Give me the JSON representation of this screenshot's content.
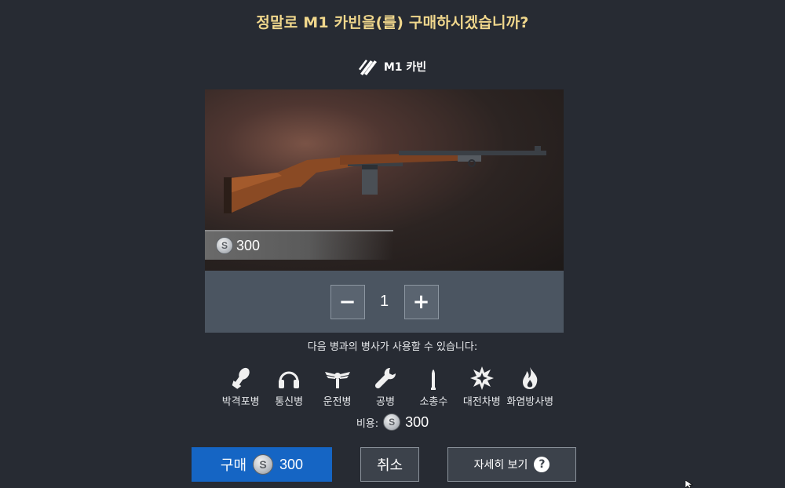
{
  "dialog": {
    "title": "정말로 M1 카빈을(를) 구매하시겠습니까?"
  },
  "weapon": {
    "icon": "ammo-icon",
    "name": "M1 카빈",
    "price": "300",
    "currency_icon": "silver-coin-icon",
    "currency_symbol": "S"
  },
  "quantity": {
    "minus_label": "−",
    "value": "1",
    "plus_label": "+"
  },
  "usable_text": "다음 병과의 병사가 사용할 수 있습니다:",
  "classes": [
    {
      "label": "박격포병",
      "icon": "mortar-shell-icon"
    },
    {
      "label": "통신병",
      "icon": "headphones-icon"
    },
    {
      "label": "운전병",
      "icon": "winged-emblem-icon"
    },
    {
      "label": "공병",
      "icon": "wrench-icon"
    },
    {
      "label": "소총수",
      "icon": "bullet-icon"
    },
    {
      "label": "대전차병",
      "icon": "explosion-icon"
    },
    {
      "label": "화염방사병",
      "icon": "flame-icon"
    }
  ],
  "cost": {
    "label": "비용:",
    "value": "300"
  },
  "buttons": {
    "buy_label": "구매",
    "buy_price": "300",
    "cancel_label": "취소",
    "details_label": "자세히 보기",
    "help_symbol": "?"
  }
}
